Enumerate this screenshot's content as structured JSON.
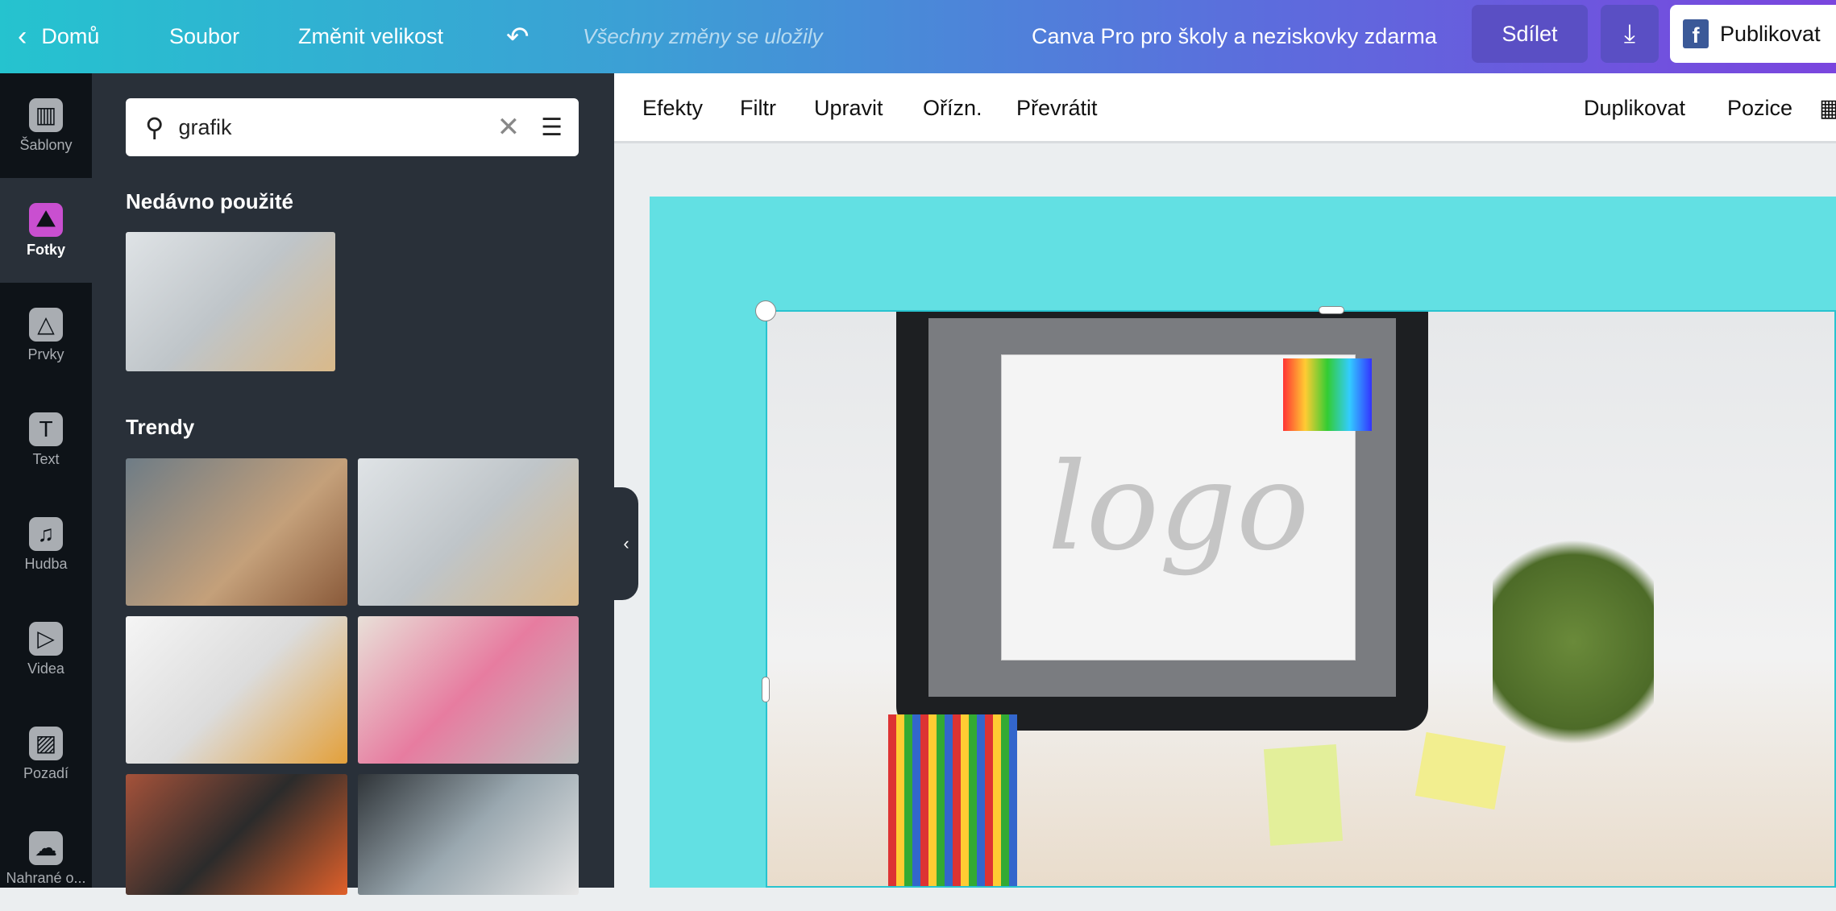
{
  "header": {
    "home": "Domů",
    "file": "Soubor",
    "resize": "Změnit velikost",
    "saved_status": "Všechny změny se uložily",
    "promo": "Canva Pro pro školy a neziskovky zdarma",
    "share": "Sdílet",
    "publish": "Publikovat"
  },
  "rail": [
    {
      "label": "Šablony",
      "icon": "templates-icon"
    },
    {
      "label": "Fotky",
      "icon": "photos-icon",
      "active": true
    },
    {
      "label": "Prvky",
      "icon": "elements-icon"
    },
    {
      "label": "Text",
      "icon": "text-icon"
    },
    {
      "label": "Hudba",
      "icon": "music-icon"
    },
    {
      "label": "Videa",
      "icon": "video-icon"
    },
    {
      "label": "Pozadí",
      "icon": "background-icon"
    },
    {
      "label": "Nahrané o...",
      "icon": "upload-icon"
    }
  ],
  "panel": {
    "search_value": "grafik",
    "recent_title": "Nedávno použité",
    "trending_title": "Trendy"
  },
  "toolbar": {
    "effects": "Efekty",
    "filter": "Filtr",
    "adjust": "Upravit",
    "crop": "Ořízn.",
    "flip": "Převrátit",
    "duplicate": "Duplikovat",
    "position": "Pozice"
  },
  "canvas": {
    "logo_text": "logo"
  },
  "colors": {
    "accent_active": "#c94fd0",
    "page_bg": "#62e0e3",
    "selection": "#28c3cf"
  }
}
